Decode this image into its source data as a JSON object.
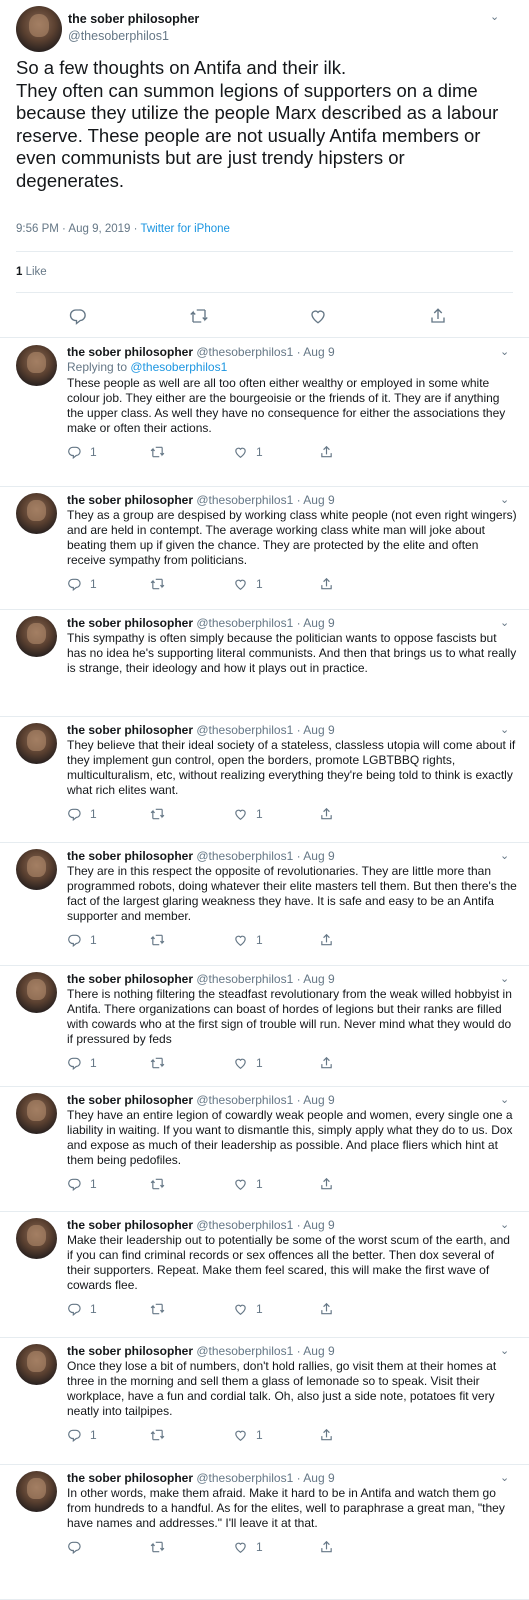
{
  "main": {
    "name": "the sober philosopher",
    "handle": "@thesoberphilos1",
    "text": "So a few thoughts on Antifa and their ilk.\nThey often can summon legions of supporters on a dime because they utilize the people Marx described as a labour reserve. These people are not usually Antifa members or even communists but are just trendy hipsters or degenerates.",
    "timestamp": "9:56 PM · Aug 9, 2019 · ",
    "source": "Twitter for iPhone",
    "like_count": "1",
    "like_label": " Like",
    "icons": [
      "reply-icon",
      "retweet-icon",
      "like-icon",
      "share-icon"
    ]
  },
  "replies": [
    {
      "name": "the sober philosopher",
      "handle": "@thesoberphilos1 · Aug 9",
      "replying_prefix": "Replying to ",
      "replying_to": "@thesoberphilos1",
      "text": "These people as well are all too often either wealthy or employed in some white colour job. They either are the bourgeoisie or the friends of it. They are if anything the upper class. As well they have no consequence for either the associations they make or often their actions.",
      "reply_count": "1",
      "retweet_count": "",
      "like_count": "1"
    },
    {
      "name": "the sober philosopher",
      "handle": "@thesoberphilos1 · Aug 9",
      "text": "They as a group are despised by working class white people (not even right wingers) and are held in contempt. The average working class white man will joke about beating them up if given the chance. They are protected by the elite and often receive sympathy from politicians.",
      "reply_count": "1",
      "retweet_count": "",
      "like_count": "1"
    },
    {
      "name": "the sober philosopher",
      "handle": "@thesoberphilos1 · Aug 9",
      "text": "This sympathy is often simply because the politician wants to oppose fascists but has no idea he's supporting literal communists. And then that brings us to what really is strange, their ideology and how it plays out in practice.",
      "reply_count": "",
      "retweet_count": "",
      "like_count": ""
    },
    {
      "name": "the sober philosopher",
      "handle": "@thesoberphilos1 · Aug 9",
      "text": "They believe that their ideal society of a stateless, classless utopia will come about if they implement gun control, open the borders, promote LGBTBBQ rights, multiculturalism, etc, without realizing everything they're being told to think is exactly what rich elites want.",
      "reply_count": "1",
      "retweet_count": "",
      "like_count": "1"
    },
    {
      "name": "the sober philosopher",
      "handle": "@thesoberphilos1 · Aug 9",
      "text": "They are in this respect the opposite of revolutionaries. They are little more than programmed robots, doing whatever their elite masters tell them. But then there's the fact of the largest glaring weakness they have. It is safe and easy to be an Antifa supporter and member.",
      "reply_count": "1",
      "retweet_count": "",
      "like_count": "1"
    },
    {
      "name": "the sober philosopher",
      "handle": "@thesoberphilos1 · Aug 9",
      "text": "There is nothing filtering the steadfast revolutionary from the weak willed hobbyist in Antifa. There organizations can boast of hordes of legions but their ranks are filled with cowards who at the first sign of trouble will run. Never mind what they would do if pressured by feds",
      "reply_count": "1",
      "retweet_count": "",
      "like_count": "1"
    },
    {
      "name": "the sober philosopher",
      "handle": "@thesoberphilos1 · Aug 9",
      "text": "They have an entire legion of cowardly weak people and women, every single one a liability in waiting. If you want to dismantle this, simply apply what they do to us. Dox and expose as much of their leadership as possible. And place fliers which hint at them being pedofiles.",
      "reply_count": "1",
      "retweet_count": "",
      "like_count": "1"
    },
    {
      "name": "the sober philosopher",
      "handle": "@thesoberphilos1 · Aug 9",
      "text": "Make their leadership out to potentially be some of the worst scum of the earth, and if you can find criminal records or sex offences all the better. Then dox several of their supporters. Repeat. Make them feel scared, this will make the first wave of cowards flee.",
      "reply_count": "1",
      "retweet_count": "",
      "like_count": "1"
    },
    {
      "name": "the sober philosopher",
      "handle": "@thesoberphilos1 · Aug 9",
      "text": "Once they lose a bit of numbers, don't hold rallies, go visit them at their homes at three in the morning and sell them a glass of lemonade so to speak. Visit their workplace, have a fun and cordial talk. Oh, also just a side note, potatoes fit very neatly into tailpipes.",
      "reply_count": "1",
      "retweet_count": "",
      "like_count": "1"
    },
    {
      "name": "the sober philosopher",
      "handle": "@thesoberphilos1 · Aug 9",
      "text": "In other words, make them afraid. Make it hard to be in Antifa and watch them go from hundreds to a handful. As for the elites, well to paraphrase a great man, \"they have names and addresses.\" I'll leave it at that.",
      "reply_count": "",
      "retweet_count": "",
      "like_count": "1"
    }
  ]
}
